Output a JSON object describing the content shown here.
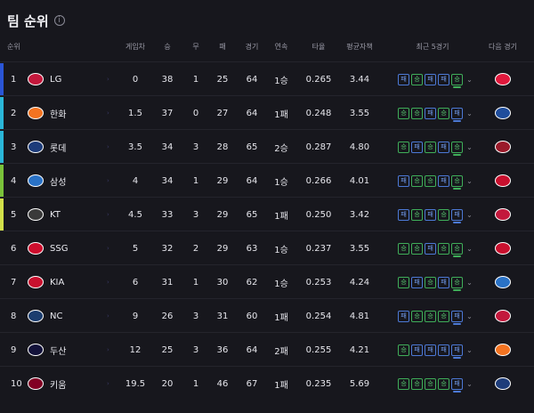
{
  "title": "팀 순위",
  "columns": [
    "순위",
    "게임차",
    "승",
    "무",
    "패",
    "경기",
    "연속",
    "타율",
    "평균자책",
    "최근 5경기",
    "다음 경기"
  ],
  "rows": [
    {
      "rank": "1",
      "team": "LG",
      "gb": "0",
      "w": "38",
      "d": "1",
      "l": "25",
      "g": "64",
      "streak": "1승",
      "avg": "0.265",
      "era": "3.44",
      "recent": [
        "패",
        "승",
        "패",
        "패",
        "승"
      ],
      "color": "#c3183c",
      "next_color": "#e0183c"
    },
    {
      "rank": "2",
      "team": "한화",
      "gb": "1.5",
      "w": "37",
      "d": "0",
      "l": "27",
      "g": "64",
      "streak": "1패",
      "avg": "0.248",
      "era": "3.55",
      "recent": [
        "승",
        "승",
        "패",
        "승",
        "패"
      ],
      "color": "#f37321",
      "next_color": "#1f4d9c"
    },
    {
      "rank": "3",
      "team": "롯데",
      "gb": "3.5",
      "w": "34",
      "d": "3",
      "l": "28",
      "g": "65",
      "streak": "2승",
      "avg": "0.287",
      "era": "4.80",
      "recent": [
        "승",
        "패",
        "승",
        "패",
        "승"
      ],
      "color": "#1d3c7a",
      "next_color": "#9a1a2a"
    },
    {
      "rank": "4",
      "team": "삼성",
      "gb": "4",
      "w": "34",
      "d": "1",
      "l": "29",
      "g": "64",
      "streak": "1승",
      "avg": "0.266",
      "era": "4.01",
      "recent": [
        "패",
        "승",
        "승",
        "패",
        "승"
      ],
      "color": "#2a72c6",
      "next_color": "#c8102e"
    },
    {
      "rank": "5",
      "team": "KT",
      "gb": "4.5",
      "w": "33",
      "d": "3",
      "l": "29",
      "g": "65",
      "streak": "1패",
      "avg": "0.250",
      "era": "3.42",
      "recent": [
        "패",
        "승",
        "패",
        "승",
        "패"
      ],
      "color": "#3a3a3a",
      "next_color": "#c3183c"
    },
    {
      "rank": "6",
      "team": "SSG",
      "gb": "5",
      "w": "32",
      "d": "2",
      "l": "29",
      "g": "63",
      "streak": "1승",
      "avg": "0.237",
      "era": "3.55",
      "recent": [
        "승",
        "승",
        "패",
        "승",
        "승"
      ],
      "color": "#ce0e2d",
      "next_color": "#c8102e"
    },
    {
      "rank": "7",
      "team": "KIA",
      "gb": "6",
      "w": "31",
      "d": "1",
      "l": "30",
      "g": "62",
      "streak": "1승",
      "avg": "0.253",
      "era": "4.24",
      "recent": [
        "승",
        "패",
        "승",
        "패",
        "승"
      ],
      "color": "#c8102e",
      "next_color": "#2a72c6"
    },
    {
      "rank": "8",
      "team": "NC",
      "gb": "9",
      "w": "26",
      "d": "3",
      "l": "31",
      "g": "60",
      "streak": "1패",
      "avg": "0.254",
      "era": "4.81",
      "recent": [
        "패",
        "승",
        "승",
        "승",
        "패"
      ],
      "color": "#1b3d6f",
      "next_color": "#c3183c"
    },
    {
      "rank": "9",
      "team": "두산",
      "gb": "12",
      "w": "25",
      "d": "3",
      "l": "36",
      "g": "64",
      "streak": "2패",
      "avg": "0.255",
      "era": "4.21",
      "recent": [
        "승",
        "패",
        "패",
        "패",
        "패"
      ],
      "color": "#13123a",
      "next_color": "#f37321"
    },
    {
      "rank": "10",
      "team": "키움",
      "gb": "19.5",
      "w": "20",
      "d": "1",
      "l": "46",
      "g": "67",
      "streak": "1패",
      "avg": "0.235",
      "era": "5.69",
      "recent": [
        "승",
        "승",
        "승",
        "승",
        "패"
      ],
      "color": "#820024",
      "next_color": "#1d3c7a"
    }
  ],
  "rank_bar_colors": [
    "#2a55d6",
    "#2ab6d8",
    "#2ab6d8",
    "#7ac23a",
    "#d2e04a"
  ]
}
